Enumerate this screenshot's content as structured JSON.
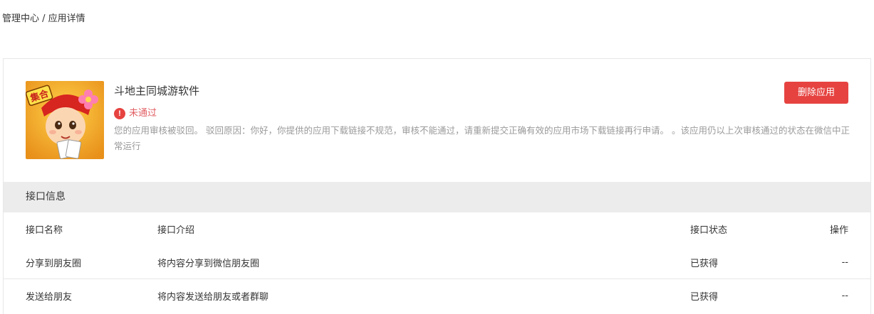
{
  "breadcrumb": "管理中心 / 应用详情",
  "app": {
    "name": "斗地主同城游软件",
    "status": "未通过",
    "review_message": "您的应用审核被驳回。 驳回原因：你好，你提供的应用下载链接不规范，审核不能通过，请重新提交正确有效的应用市场下载链接再行申请。 。该应用仍以上次审核通过的状态在微信中正常运行",
    "icon_badge": "集合",
    "delete_label": "删除应用"
  },
  "api_section": {
    "title": "接口信息",
    "columns": [
      "接口名称",
      "接口介绍",
      "接口状态",
      "操作"
    ],
    "rows": [
      {
        "name": "分享到朋友圈",
        "desc": "将内容分享到微信朋友圈",
        "status": "已获得",
        "action": "--"
      },
      {
        "name": "发送给朋友",
        "desc": "将内容发送给朋友或者群聊",
        "status": "已获得",
        "action": "--"
      }
    ]
  },
  "colors": {
    "danger": "#e64340",
    "status_text": "#e15f63",
    "muted": "#9a9a9a",
    "section_bg": "#ececec"
  }
}
